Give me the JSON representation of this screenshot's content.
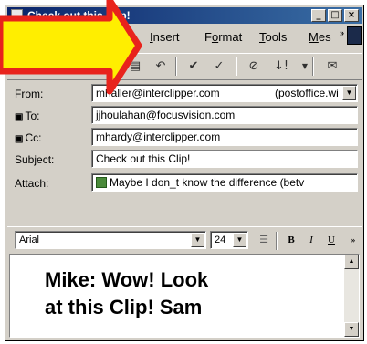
{
  "window": {
    "title": "Check out this Clip!",
    "controls": {
      "minimize": "_",
      "maximize": "□",
      "close": "×"
    }
  },
  "menu": {
    "items": [
      {
        "pre": "",
        "ul": "I",
        "post": "nsert"
      },
      {
        "pre": "F",
        "ul": "o",
        "post": "rmat"
      },
      {
        "pre": "",
        "ul": "T",
        "post": "ools"
      },
      {
        "pre": "",
        "ul": "M",
        "post": "es"
      }
    ],
    "overflow": "»"
  },
  "toolbar": {
    "icons": [
      "cut-icon",
      "copy-icon",
      "paste-icon",
      "undo-icon",
      "check-names-icon",
      "spelling-icon",
      "attach-icon",
      "priority-icon",
      "send-options-icon"
    ]
  },
  "header": {
    "from_label": "From:",
    "from_value": "mhaller@interclipper.com",
    "from_account": "(postoffice.wi",
    "to_label": "To:",
    "to_value": "jjhoulahan@focusvision.com",
    "cc_label": "Cc:",
    "cc_value": "mhardy@interclipper.com",
    "subject_label": "Subject:",
    "subject_value": "Check out this Clip!",
    "attach_label": "Attach:",
    "attach_value": "Maybe I don_t know the difference (betv"
  },
  "format": {
    "font": "Arial",
    "size": "24",
    "bold": "B",
    "italic": "I",
    "underline": "U",
    "overflow": "»"
  },
  "body": {
    "line1": "Mike:  Wow! Look",
    "line2": "at this Clip!  Sam"
  },
  "colors": {
    "arrow_fill": "#ffee00",
    "arrow_outline": "#e8231c",
    "title_bar": "#0a246a"
  }
}
